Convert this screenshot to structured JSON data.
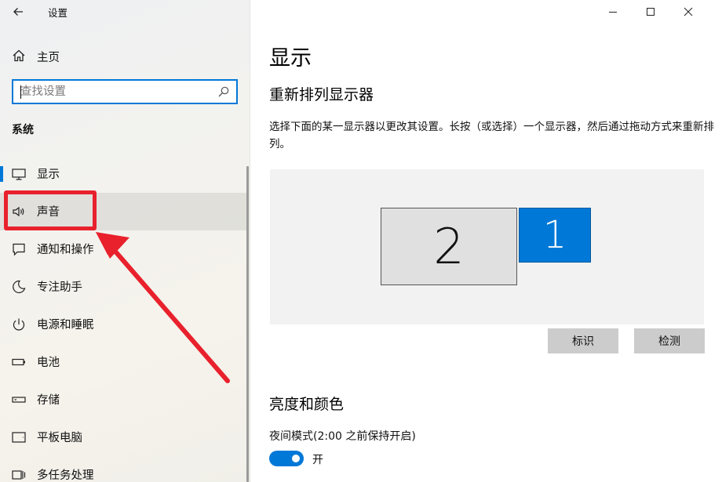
{
  "window": {
    "title": "设置"
  },
  "sidebar": {
    "home_label": "主页",
    "search": {
      "placeholder": "查找设置"
    },
    "section_title": "系统",
    "items": [
      {
        "label": "显示",
        "icon": "monitor-icon",
        "selected": true
      },
      {
        "label": "声音",
        "icon": "speaker-icon",
        "hover": true
      },
      {
        "label": "通知和操作",
        "icon": "notification-icon"
      },
      {
        "label": "专注助手",
        "icon": "moon-icon"
      },
      {
        "label": "电源和睡眠",
        "icon": "power-icon"
      },
      {
        "label": "电池",
        "icon": "battery-icon"
      },
      {
        "label": "存储",
        "icon": "storage-icon"
      },
      {
        "label": "平板电脑",
        "icon": "tablet-icon"
      },
      {
        "label": "多任务处理",
        "icon": "multitask-icon"
      }
    ]
  },
  "content": {
    "page_title": "显示",
    "rearrange_title": "重新排列显示器",
    "rearrange_desc": "选择下面的某一显示器以更改其设置。长按（或选择）一个显示器，然后通过拖动方式来重新排列。",
    "monitors": [
      {
        "label": "2"
      },
      {
        "label": "1",
        "selected": true
      }
    ],
    "identify_button": "标识",
    "detect_button": "检测",
    "brightness_title": "亮度和颜色",
    "night_mode_label": "夜间模式(2:00 之前保持开启)",
    "night_mode_state": "开"
  },
  "colors": {
    "accent": "#0078d7",
    "annotation": "#e8212c"
  }
}
